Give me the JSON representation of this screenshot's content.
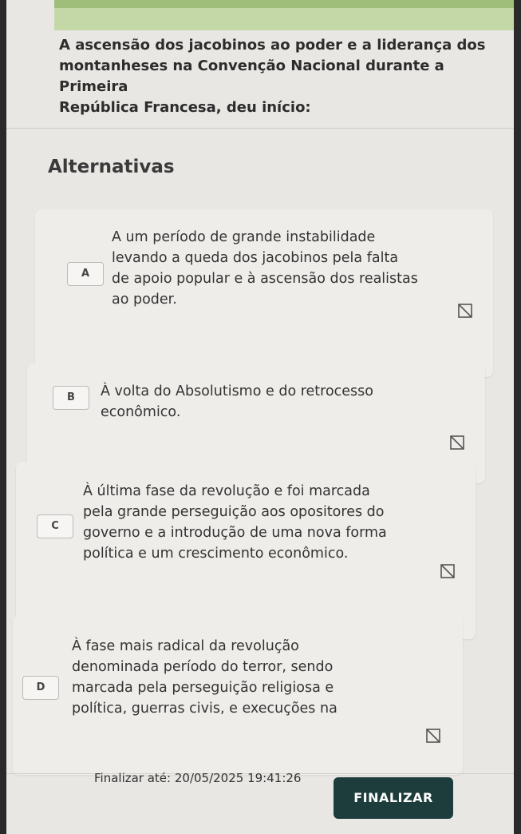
{
  "question": {
    "line1": "A ascensão dos jacobinos ao poder e a liderança dos",
    "line2": "montanheses na Convenção Nacional durante a Primeira",
    "line3": "República Francesa, deu início:"
  },
  "alternatives_title": "Alternativas",
  "options": [
    {
      "letter": "A",
      "lines": [
        "A um período de grande instabilidade",
        "levando a queda dos jacobinos pela falta",
        "de apoio popular e à ascensão dos realistas",
        "ao poder."
      ]
    },
    {
      "letter": "B",
      "lines": [
        "À volta do Absolutismo e do retrocesso",
        "econômico."
      ]
    },
    {
      "letter": "C",
      "lines": [
        "À última fase da revolução e foi marcada",
        "pela grande perseguição aos opositores do",
        "governo e a introdução de uma nova forma",
        "política e um crescimento econômico."
      ]
    },
    {
      "letter": "D",
      "lines": [
        "À fase mais radical da revolução",
        "denominada período do terror, sendo",
        "marcada pela perseguição religiosa e",
        "política, guerras civis, e execuções na"
      ]
    }
  ],
  "footer": {
    "deadline": "Finalizar até: 20/05/2025 19:41:26",
    "finalize_label": "FINALIZAR"
  },
  "colors": {
    "button_bg": "#1d3d3c",
    "accent_strip": "#c4d8a7"
  },
  "icons": {
    "eliminate": "strikethrough-icon"
  }
}
